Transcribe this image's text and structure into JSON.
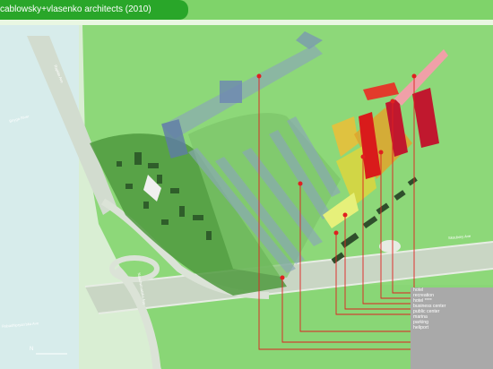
{
  "header": {
    "title": "cablowsky+vlasenko architects (2010)"
  },
  "legend": {
    "items": [
      "hotel",
      "recreation",
      "hotel ****",
      "business center",
      "public center",
      "marina",
      "parking",
      "heliport"
    ]
  },
  "map_labels": {
    "river": "Biryga River",
    "road_left": "Rabashipryan'ska Ave",
    "road_right": "Skoubiny Ave",
    "road_center": "Naschvirvatska Ave",
    "north_road": "Rapida Ave"
  },
  "scale_text": "N"
}
